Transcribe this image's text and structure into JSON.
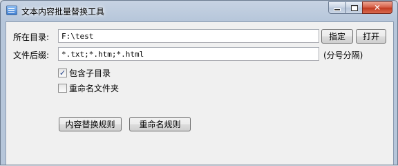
{
  "window": {
    "title": "文本内容批量替换工具",
    "controls": {
      "minimize": "minimize",
      "maximize": "maximize",
      "close": "✕"
    }
  },
  "form": {
    "dir_label": "所在目录:",
    "dir_value": "F:\\test",
    "set_button": "指定",
    "open_button": "打开",
    "ext_label": "文件后缀:",
    "ext_value": "*.txt;*.htm;*.html",
    "ext_hint": "(分号分隔)",
    "subdir_label": "包含子目录",
    "subdir_checked": true,
    "rename_folder_label": "重命名文件夹",
    "rename_folder_checked": false
  },
  "actions": {
    "content_rules": "内容替换规则",
    "rename_rules": "重命名规则"
  },
  "icons": {
    "app": "app-window-icon",
    "check": "✓"
  }
}
